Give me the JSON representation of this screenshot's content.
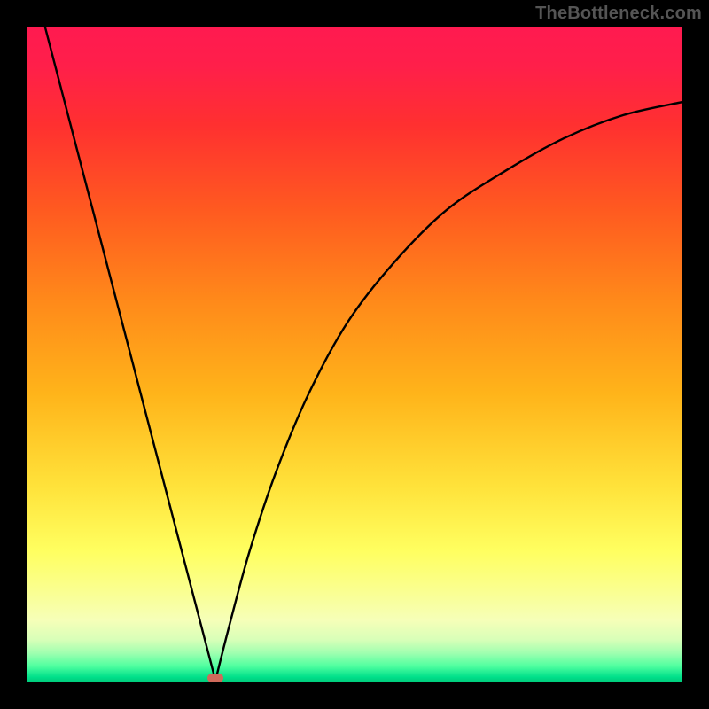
{
  "watermark": {
    "text": "TheBottleneck.com"
  },
  "marker": {
    "color": "#cf6a5b",
    "x_frac": 0.288,
    "y_frac": 0.994
  },
  "gradient": {
    "stops": [
      {
        "offset": 0.0,
        "color": "#ff1a50"
      },
      {
        "offset": 0.06,
        "color": "#ff1f4a"
      },
      {
        "offset": 0.15,
        "color": "#ff3030"
      },
      {
        "offset": 0.28,
        "color": "#ff5a20"
      },
      {
        "offset": 0.42,
        "color": "#ff8a1a"
      },
      {
        "offset": 0.56,
        "color": "#ffb41a"
      },
      {
        "offset": 0.7,
        "color": "#ffe23a"
      },
      {
        "offset": 0.8,
        "color": "#ffff60"
      },
      {
        "offset": 0.86,
        "color": "#faff90"
      },
      {
        "offset": 0.905,
        "color": "#f6ffb8"
      },
      {
        "offset": 0.935,
        "color": "#d8ffb8"
      },
      {
        "offset": 0.955,
        "color": "#a0ffb0"
      },
      {
        "offset": 0.975,
        "color": "#50ffa0"
      },
      {
        "offset": 0.992,
        "color": "#00e08a"
      },
      {
        "offset": 1.0,
        "color": "#00c878"
      }
    ]
  },
  "chart_data": {
    "type": "line",
    "title": "",
    "xlabel": "",
    "ylabel": "",
    "xlim": [
      0,
      1
    ],
    "ylim": [
      0,
      1
    ],
    "grid": false,
    "description": "V-shaped bottleneck curve: straight descent from top-left to the minimum near x≈0.29 at y≈0, then a concave-down rise toward the top-right corner. Values are normalized fractions of the plot area.",
    "series": [
      {
        "name": "left-branch",
        "x": [
          0.028,
          0.288
        ],
        "y": [
          1.0,
          0.003
        ]
      },
      {
        "name": "right-branch",
        "x": [
          0.288,
          0.31,
          0.34,
          0.38,
          0.43,
          0.49,
          0.56,
          0.64,
          0.73,
          0.82,
          0.91,
          1.0
        ],
        "y": [
          0.003,
          0.09,
          0.2,
          0.32,
          0.44,
          0.55,
          0.64,
          0.72,
          0.78,
          0.83,
          0.865,
          0.885
        ]
      }
    ],
    "minimum": {
      "x": 0.288,
      "y": 0.003
    }
  }
}
